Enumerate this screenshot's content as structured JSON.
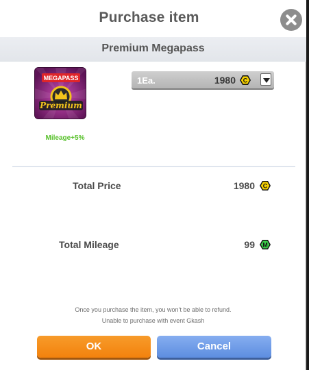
{
  "dialog": {
    "title": "Purchase item",
    "subtitle": "Premium Megapass"
  },
  "item": {
    "icon_banner": "MEGAPASS",
    "icon_script": "Premium",
    "mileage_bonus": "Mileage+5%"
  },
  "quantity": {
    "label": "1Ea.",
    "price": "1980",
    "currency_icon": "c-coin-icon"
  },
  "totals": {
    "price_label": "Total Price",
    "price_value": "1980",
    "price_icon": "c-coin-icon",
    "mileage_label": "Total Mileage",
    "mileage_value": "99",
    "mileage_icon": "m-coin-icon"
  },
  "notices": {
    "line1": "Once you purchase the item, you won’t be able to refund.",
    "line2": "Unable to purchase with event Gkash"
  },
  "buttons": {
    "ok": "OK",
    "cancel": "Cancel"
  },
  "colors": {
    "ok_button": "#f3820d",
    "cancel_button": "#5d8ee0",
    "mileage_green": "#57c02a",
    "c_coin": "#f5d000",
    "m_coin": "#3bd14a"
  }
}
